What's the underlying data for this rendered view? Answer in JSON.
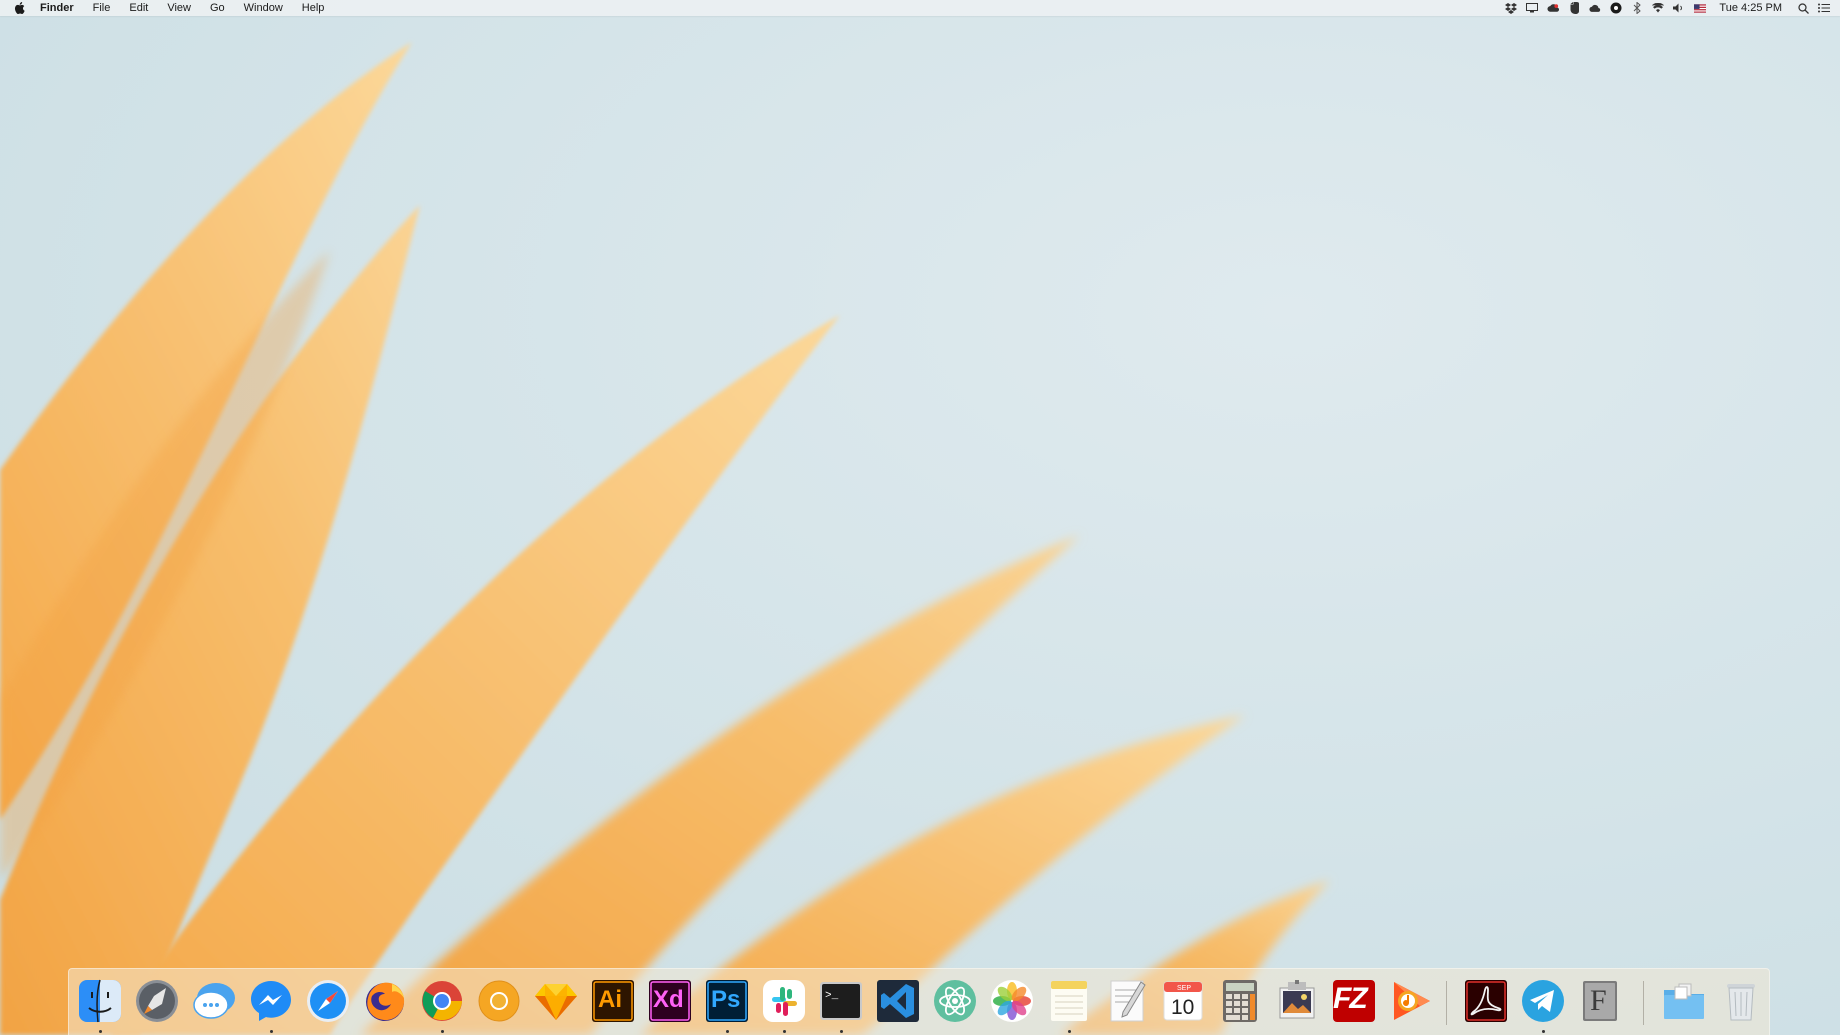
{
  "menubar": {
    "app_name": "Finder",
    "items": [
      "File",
      "Edit",
      "View",
      "Go",
      "Window",
      "Help"
    ],
    "clock": "Tue 4:25 PM",
    "status_icons": [
      "dropbox-icon",
      "display-icon",
      "creative-cloud-icon",
      "evernote-icon",
      "cloud-icon",
      "record-icon",
      "bluetooth-icon",
      "wifi-icon",
      "volume-icon",
      "us-flag-icon"
    ],
    "spotlight_icon": "search-icon",
    "notifications_icon": "list-icon"
  },
  "dock": {
    "apps": [
      {
        "name": "finder-icon",
        "label": "",
        "running": true
      },
      {
        "name": "launchpad-icon",
        "label": "",
        "running": false
      },
      {
        "name": "messages-icon",
        "label": "",
        "running": false
      },
      {
        "name": "messenger-icon",
        "label": "",
        "running": true
      },
      {
        "name": "safari-icon",
        "label": "",
        "running": false
      },
      {
        "name": "firefox-icon",
        "label": "",
        "running": false
      },
      {
        "name": "chrome-icon",
        "label": "",
        "running": true
      },
      {
        "name": "chrome-canary-icon",
        "label": "",
        "running": false
      },
      {
        "name": "sketch-icon",
        "label": "",
        "running": false
      },
      {
        "name": "illustrator-icon",
        "label": "Ai",
        "running": false
      },
      {
        "name": "adobe-xd-icon",
        "label": "Xd",
        "running": false
      },
      {
        "name": "photoshop-icon",
        "label": "Ps",
        "running": true
      },
      {
        "name": "slack-icon",
        "label": "",
        "running": true
      },
      {
        "name": "terminal-icon",
        "label": ">_",
        "running": true
      },
      {
        "name": "vscode-icon",
        "label": "",
        "running": false
      },
      {
        "name": "atom-icon",
        "label": "",
        "running": false
      },
      {
        "name": "photos-icon",
        "label": "",
        "running": false
      },
      {
        "name": "notes-icon",
        "label": "",
        "running": true
      },
      {
        "name": "textedit-icon",
        "label": "",
        "running": false
      },
      {
        "name": "calendar-icon",
        "label": "10",
        "month": "SEP",
        "running": false
      },
      {
        "name": "calculator-icon",
        "label": "",
        "running": false
      },
      {
        "name": "preview-icon",
        "label": "",
        "running": false
      },
      {
        "name": "filezilla-icon",
        "label": "FZ",
        "running": false
      },
      {
        "name": "google-play-music-icon",
        "label": "",
        "running": false
      },
      {
        "name": "acrobat-icon",
        "label": "",
        "running": false
      },
      {
        "name": "telegram-icon",
        "label": "",
        "running": true
      },
      {
        "name": "font-book-icon",
        "label": "F",
        "running": false
      },
      {
        "name": "downloads-folder-icon",
        "label": "",
        "running": false
      },
      {
        "name": "trash-icon",
        "label": "",
        "running": false
      }
    ]
  },
  "colors": {
    "petal": "#f6b760",
    "petal_light": "#fbd99b",
    "sky": "#d5e4e9",
    "illustrator": "#ff9a00",
    "xd": "#ff61f6",
    "photoshop": "#31a8ff",
    "filezilla": "#bf0000"
  }
}
